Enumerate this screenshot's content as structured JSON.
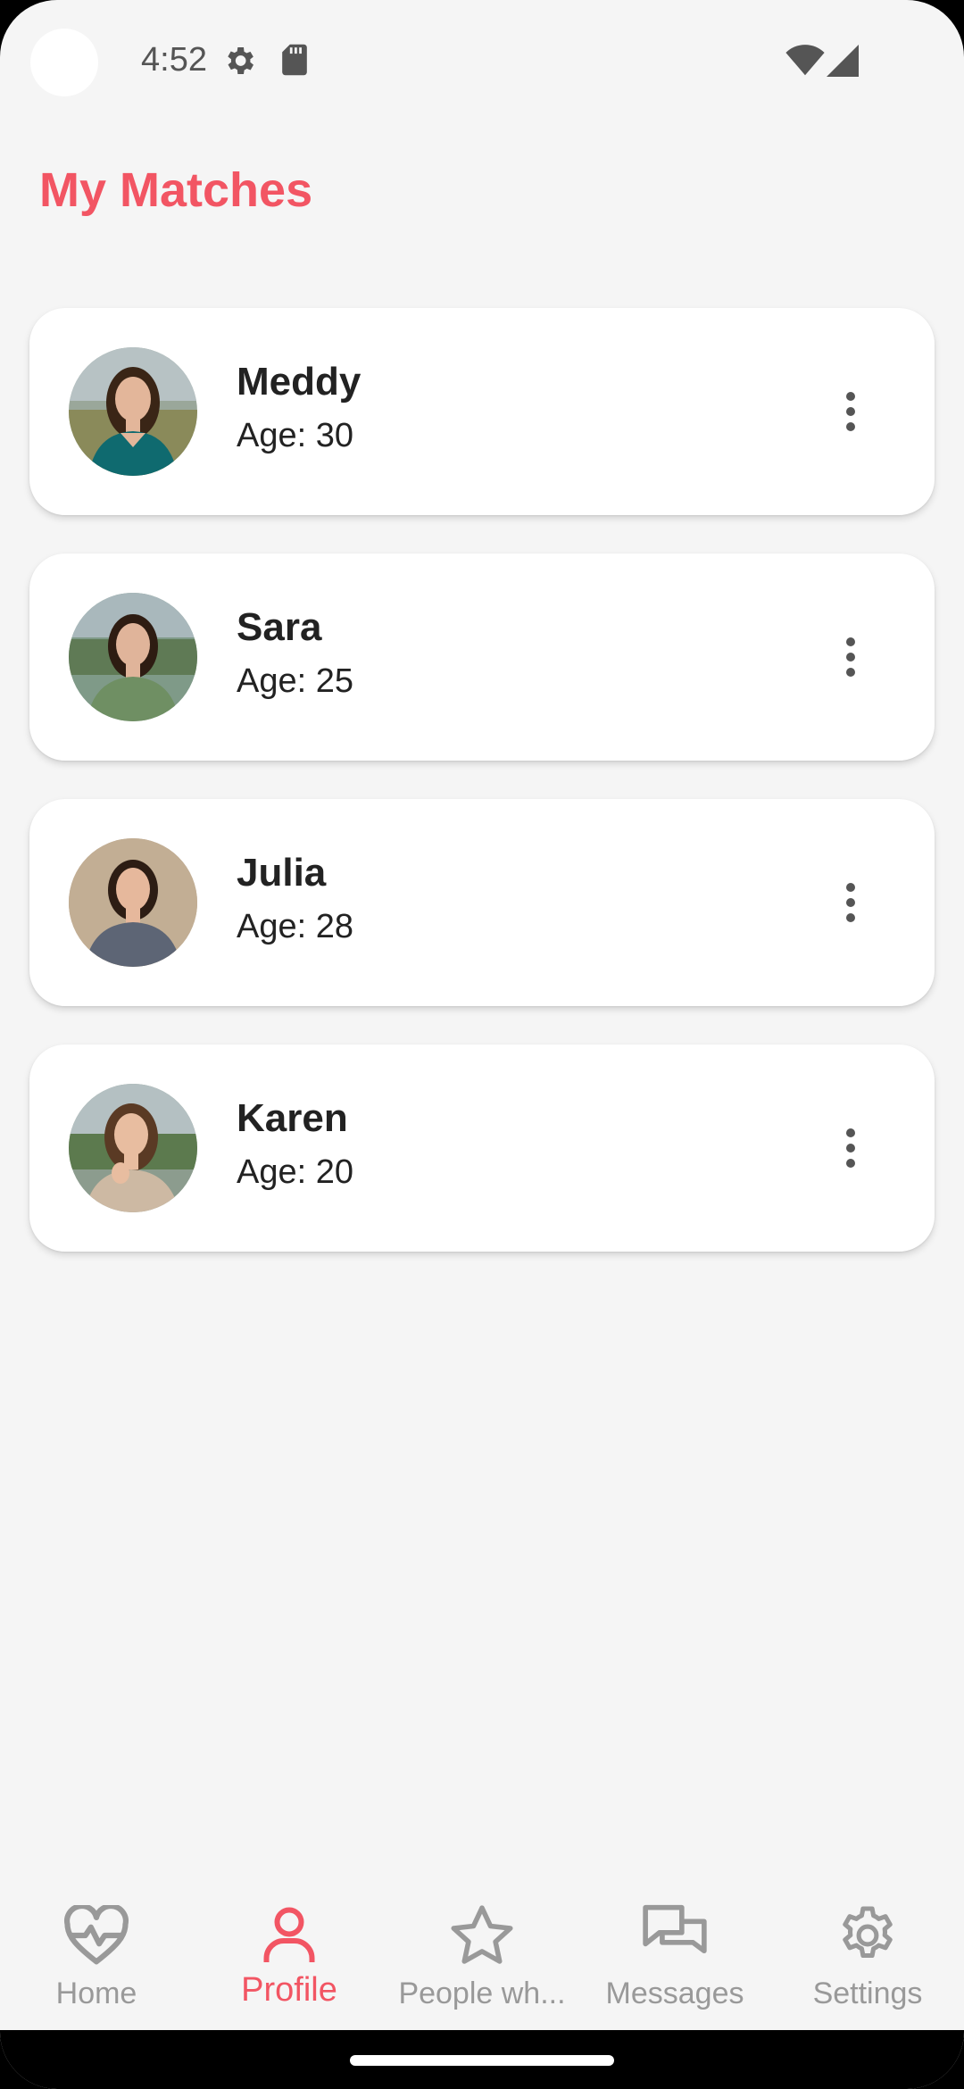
{
  "status_bar": {
    "time": "4:52",
    "icons": [
      "settings-gear-icon",
      "sd-card-icon",
      "wifi-icon",
      "cell-signal-icon"
    ]
  },
  "page": {
    "title": "My Matches"
  },
  "matches": [
    {
      "name": "Meddy",
      "age": "Age: 30",
      "shirt_color": "#0f6a6f",
      "bg_color": "#8a9a86",
      "hair_color": "#3a2516"
    },
    {
      "name": "Sara",
      "age": "Age: 25",
      "shirt_color": "#6f8f63",
      "bg_color": "#7f9a88",
      "hair_color": "#2e1c12"
    },
    {
      "name": "Julia",
      "age": "Age: 28",
      "shirt_color": "#5d6575",
      "bg_color": "#b8a48a",
      "hair_color": "#2d1d14"
    },
    {
      "name": "Karen",
      "age": "Age: 20",
      "shirt_color": "#cdb9a3",
      "bg_color": "#8c9c8e",
      "hair_color": "#5a3a24"
    }
  ],
  "bottom_nav": {
    "items": [
      {
        "label": "Home",
        "icon": "heart-pulse-icon",
        "active": false
      },
      {
        "label": "Profile",
        "icon": "person-icon",
        "active": true
      },
      {
        "label": "People wh...",
        "icon": "star-icon",
        "active": false
      },
      {
        "label": "Messages",
        "icon": "chat-bubbles-icon",
        "active": false
      },
      {
        "label": "Settings",
        "icon": "gear-icon",
        "active": false
      }
    ]
  },
  "colors": {
    "accent": "#f25563",
    "inactive": "#999999",
    "background": "#f5f5f5"
  }
}
